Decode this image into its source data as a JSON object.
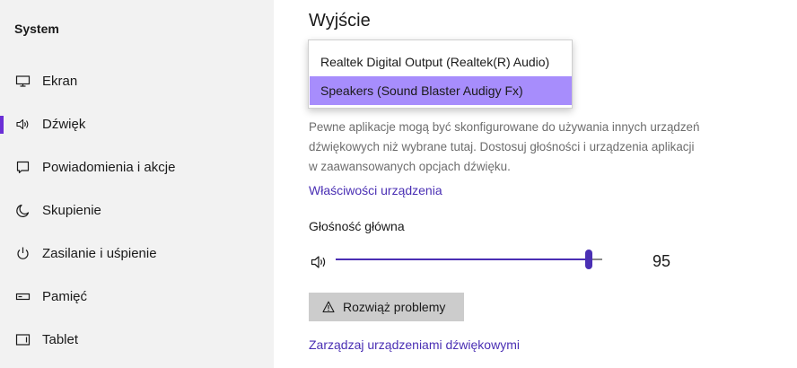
{
  "sidebar": {
    "heading": "System",
    "items": [
      {
        "label": "Ekran",
        "icon": "monitor-icon"
      },
      {
        "label": "Dźwięk",
        "icon": "speaker-icon",
        "selected": true
      },
      {
        "label": "Powiadomienia i akcje",
        "icon": "notification-icon"
      },
      {
        "label": "Skupienie",
        "icon": "moon-icon"
      },
      {
        "label": "Zasilanie i uśpienie",
        "icon": "power-icon"
      },
      {
        "label": "Pamięć",
        "icon": "storage-icon"
      },
      {
        "label": "Tablet",
        "icon": "tablet-icon"
      }
    ]
  },
  "main": {
    "section_title": "Wyjście",
    "output_dropdown": {
      "options": [
        "Realtek Digital Output (Realtek(R) Audio)",
        "Speakers (Sound Blaster Audigy Fx)"
      ],
      "selected": "Speakers (Sound Blaster Audigy Fx)"
    },
    "description": "Pewne aplikacje mogą być skonfigurowane do używania innych urządzeń dźwiękowych niż wybrane tutaj. Dostosuj głośności i urządzenia aplikacji w zaawansowanych opcjach dźwięku.",
    "device_properties_link": "Właściwości urządzenia",
    "master_volume": {
      "label": "Głośność główna",
      "value": 95,
      "value_text": "95"
    },
    "troubleshoot_button": "Rozwiąż problemy",
    "manage_devices_link": "Zarządzaj urządzeniami dźwiękowymi"
  },
  "colors": {
    "accent": "#4a2fb4",
    "selected_option": "#a78dfc",
    "sidebar_bg": "#f2f2f2",
    "button_bg": "#cccccc"
  }
}
